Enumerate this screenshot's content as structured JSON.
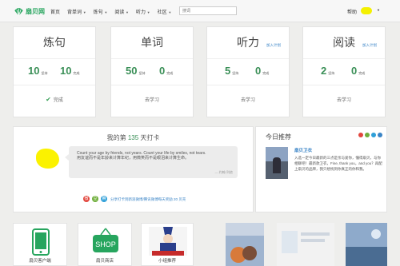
{
  "nav": {
    "logo_text": "扇贝网",
    "items": [
      {
        "label": "首页",
        "has_menu": false
      },
      {
        "label": "背单词",
        "has_menu": true
      },
      {
        "label": "炼句",
        "has_menu": true
      },
      {
        "label": "阅读",
        "has_menu": true
      },
      {
        "label": "听力",
        "has_menu": true
      },
      {
        "label": "社区",
        "has_menu": true
      }
    ],
    "search_placeholder": "搜词",
    "help_label": "帮助",
    "brand_color": "#27a55e"
  },
  "cards": [
    {
      "title": "炼句",
      "plan": "",
      "a_num": "10",
      "a_lbl": "坚持",
      "b_num": "10",
      "b_lbl": "完成",
      "action": "完成",
      "done": true
    },
    {
      "title": "单词",
      "plan": "",
      "a_num": "50",
      "a_lbl": "坚持",
      "b_num": "0",
      "b_lbl": "完成",
      "action": "去学习",
      "done": false
    },
    {
      "title": "听力",
      "plan": "加入计划",
      "a_num": "5",
      "a_lbl": "坚持",
      "b_num": "0",
      "b_lbl": "完成",
      "action": "去学习",
      "done": false
    },
    {
      "title": "阅读",
      "plan": "加入计划",
      "a_num": "2",
      "a_lbl": "坚持",
      "b_num": "0",
      "b_lbl": "完成",
      "action": "去学习",
      "done": false
    }
  ],
  "checkin": {
    "prefix": "我的第",
    "days": "135",
    "suffix": "天打卡",
    "quote_en": "Count your age by friends, not years. Count your life by smiles, not tears.",
    "quote_cn": "用友谊而不是年龄来计算年纪，用微笑而不是眼泪来计算生命。",
    "quote_src": "— 约翰·列侬",
    "share_note": "分享打卡到新浪微博/腾讯微博每天奖励 20 贝壳"
  },
  "recommend": {
    "heading": "今日推荐",
    "name": "扇贝卫衣",
    "desc": "入选一定今日最新的三点是亲与爱你，懂得扇贝，与你相聊吧！最新款卫衣，Fine, thank you，and you？再配上扇贝的品牌，我只想找到你真正的你和我。"
  },
  "tiles": [
    {
      "caption": "扇贝客户端"
    },
    {
      "caption": "扇贝商店"
    },
    {
      "caption": "小组推荐"
    }
  ]
}
